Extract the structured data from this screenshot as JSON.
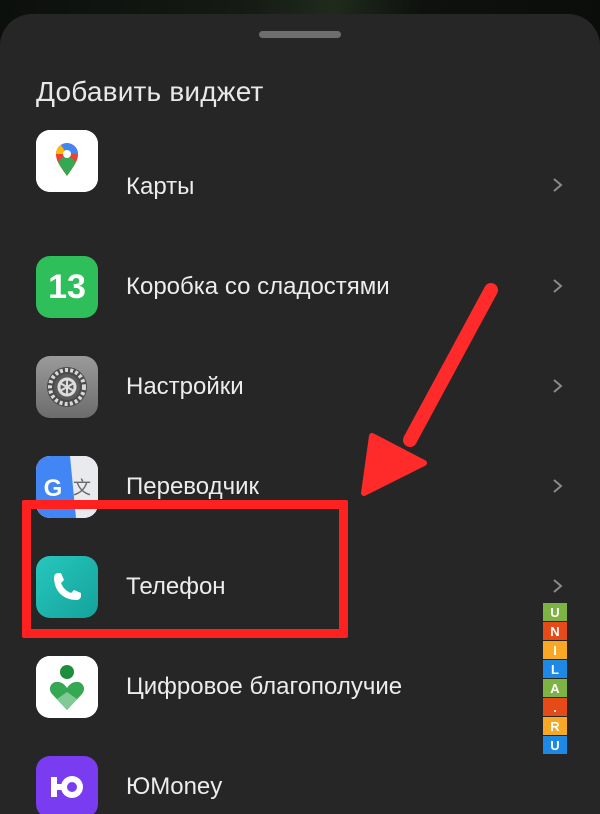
{
  "sheet": {
    "title": "Добавить виджет"
  },
  "apps": [
    {
      "label": "Карты",
      "icon": "google-maps-icon"
    },
    {
      "label": "Коробка со сладостями",
      "icon": "sweets-box-icon",
      "icon_text": "13"
    },
    {
      "label": "Настройки",
      "icon": "settings-gear-icon"
    },
    {
      "label": "Переводчик",
      "icon": "google-translate-icon",
      "icon_text": "G"
    },
    {
      "label": "Телефон",
      "icon": "phone-icon"
    },
    {
      "label": "Цифровое благополучие",
      "icon": "digital-wellbeing-icon"
    },
    {
      "label": "ЮMoney",
      "icon": "yumoney-icon"
    }
  ],
  "watermark": {
    "letters": [
      "U",
      "N",
      "I",
      "L",
      "A",
      ".",
      "R",
      "U"
    ]
  },
  "colors": {
    "sheet_bg": "#262626",
    "text": "#ececec",
    "highlight": "#ff2020",
    "sweets_green": "#2fbf5a",
    "phone_teal": "#1eb9b0",
    "yumoney_purple": "#7a3cf0"
  }
}
